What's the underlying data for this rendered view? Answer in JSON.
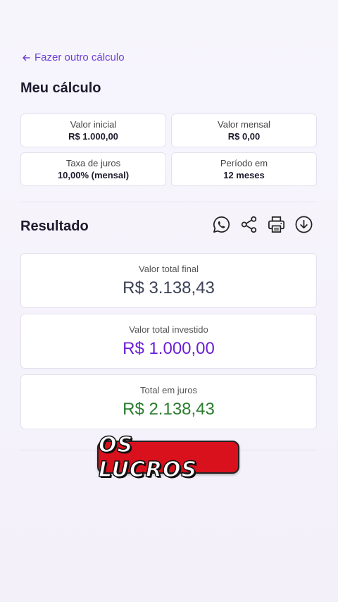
{
  "back_link": {
    "label": "Fazer outro cálculo",
    "icon": "arrow-left-icon"
  },
  "calc": {
    "title": "Meu cálculo",
    "fields": [
      {
        "label": "Valor inicial",
        "value": "R$ 1.000,00"
      },
      {
        "label": "Valor mensal",
        "value": "R$ 0,00"
      },
      {
        "label": "Taxa de juros",
        "value": "10,00% (mensal)"
      },
      {
        "label": "Período em",
        "value": "12 meses"
      }
    ]
  },
  "result": {
    "title": "Resultado",
    "actions": [
      "whatsapp-icon",
      "share-icon",
      "print-icon",
      "download-icon"
    ],
    "cards": [
      {
        "label": "Valor total final",
        "amount": "R$ 3.138,43",
        "color": "#3b4256"
      },
      {
        "label": "Valor total investido",
        "amount": "R$ 1.000,00",
        "color": "#6a1fd8"
      },
      {
        "label": "Total em juros",
        "amount": "R$ 2.138,43",
        "color": "#2a7d2e"
      }
    ]
  },
  "overlay": {
    "text": "OS LUCROS",
    "color": "#d8111d"
  },
  "colors": {
    "accent": "#6d3fd6",
    "background": "#f5f3fb"
  }
}
